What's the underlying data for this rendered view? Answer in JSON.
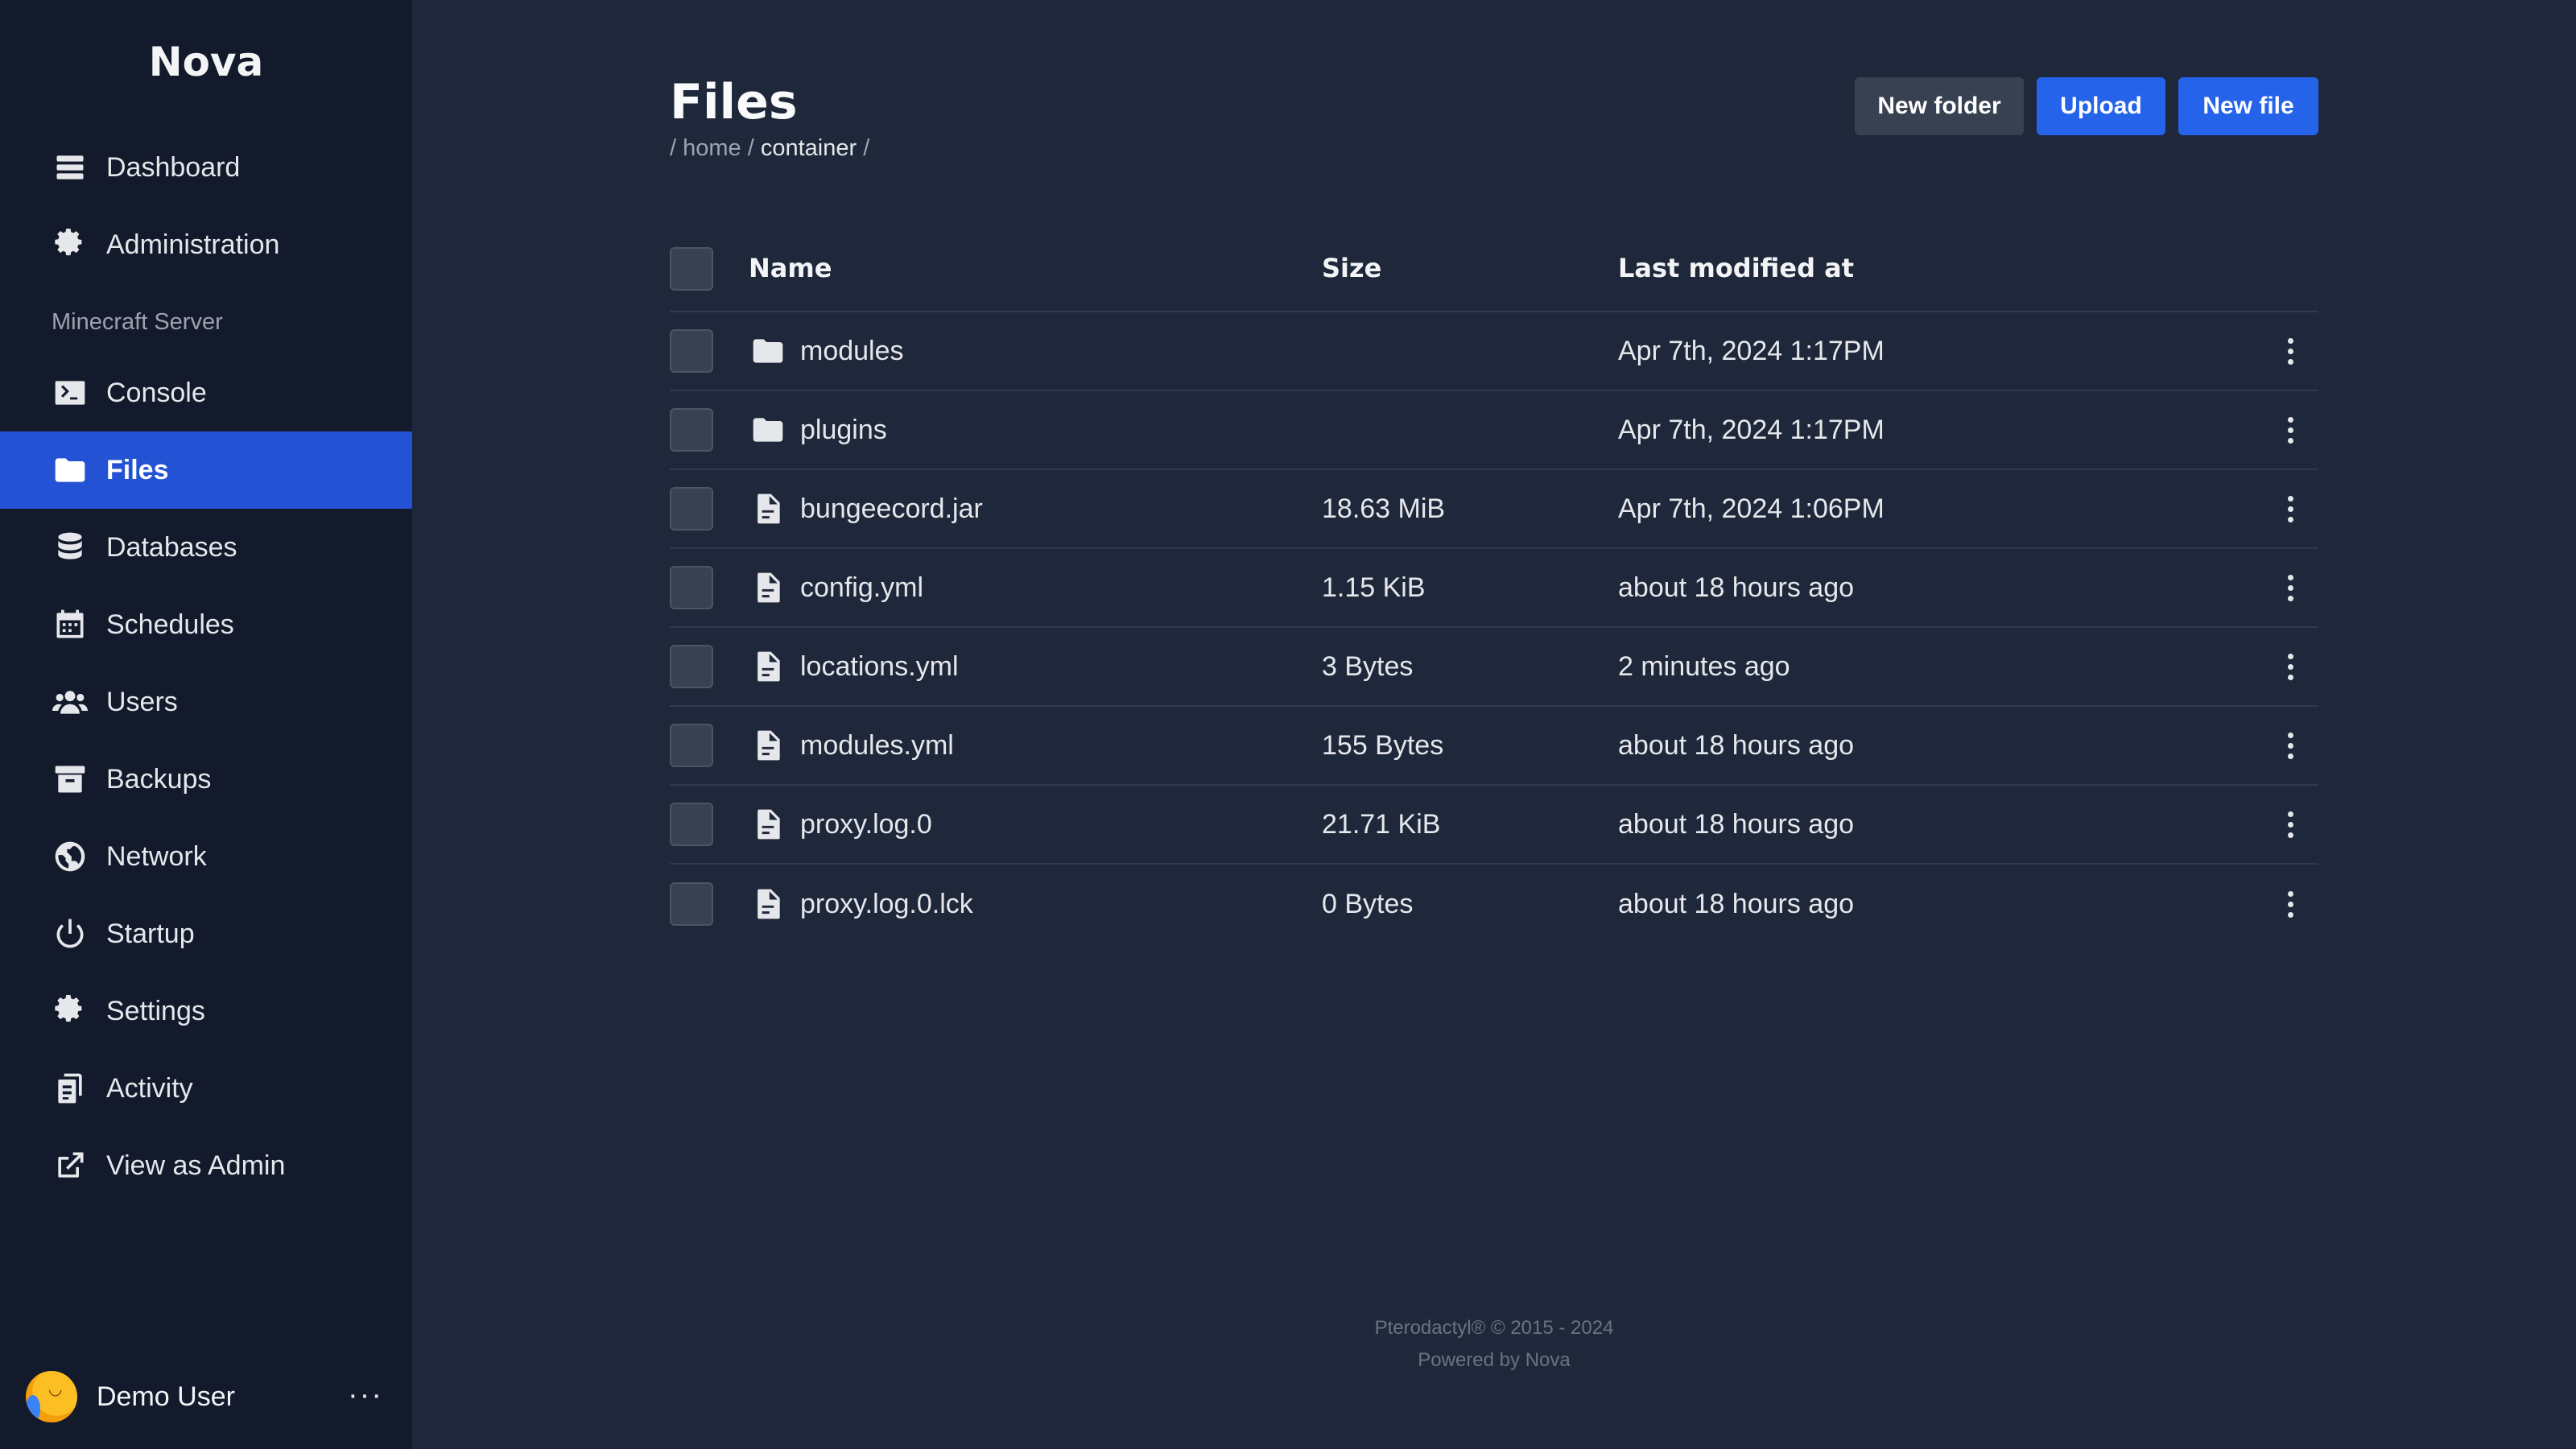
{
  "app": {
    "brand": "Nova"
  },
  "sidebar": {
    "top_items": [
      {
        "label": "Dashboard",
        "icon": "dashboard-icon"
      },
      {
        "label": "Administration",
        "icon": "gear-icon"
      }
    ],
    "section_label": "Minecraft Server",
    "items": [
      {
        "label": "Console",
        "icon": "terminal-icon"
      },
      {
        "label": "Files",
        "icon": "folder-icon",
        "active": true
      },
      {
        "label": "Databases",
        "icon": "database-icon"
      },
      {
        "label": "Schedules",
        "icon": "calendar-icon"
      },
      {
        "label": "Users",
        "icon": "users-icon"
      },
      {
        "label": "Backups",
        "icon": "archive-icon"
      },
      {
        "label": "Network",
        "icon": "globe-icon"
      },
      {
        "label": "Startup",
        "icon": "power-icon"
      },
      {
        "label": "Settings",
        "icon": "gear-icon"
      },
      {
        "label": "Activity",
        "icon": "clipboard-icon"
      },
      {
        "label": "View as Admin",
        "icon": "external-link-icon"
      }
    ],
    "user": {
      "name": "Demo User",
      "more": "···"
    }
  },
  "page": {
    "title": "Files",
    "breadcrumb": {
      "sep1": "/ ",
      "home": "home",
      "sep2": " / ",
      "current": "container",
      "sep3": " /"
    },
    "actions": {
      "new_folder": "New folder",
      "upload": "Upload",
      "new_file": "New file"
    }
  },
  "table": {
    "headers": {
      "name": "Name",
      "size": "Size",
      "modified": "Last modified at"
    },
    "rows": [
      {
        "name": "modules",
        "type": "folder",
        "size": "",
        "modified": "Apr 7th, 2024 1:17PM"
      },
      {
        "name": "plugins",
        "type": "folder",
        "size": "",
        "modified": "Apr 7th, 2024 1:17PM"
      },
      {
        "name": "bungeecord.jar",
        "type": "file",
        "size": "18.63 MiB",
        "modified": "Apr 7th, 2024 1:06PM"
      },
      {
        "name": "config.yml",
        "type": "file",
        "size": "1.15 KiB",
        "modified": "about 18 hours ago"
      },
      {
        "name": "locations.yml",
        "type": "file",
        "size": "3 Bytes",
        "modified": "2 minutes ago"
      },
      {
        "name": "modules.yml",
        "type": "file",
        "size": "155 Bytes",
        "modified": "about 18 hours ago"
      },
      {
        "name": "proxy.log.0",
        "type": "file",
        "size": "21.71 KiB",
        "modified": "about 18 hours ago"
      },
      {
        "name": "proxy.log.0.lck",
        "type": "file",
        "size": "0 Bytes",
        "modified": "about 18 hours ago"
      }
    ]
  },
  "footer": {
    "copyright": "Pterodactyl® © 2015 - 2024",
    "powered": "Powered by Nova"
  },
  "colors": {
    "accent": "#2563eb",
    "active_nav": "#2452d4",
    "sidebar_bg": "#121a2b",
    "main_bg": "#1e283a"
  }
}
